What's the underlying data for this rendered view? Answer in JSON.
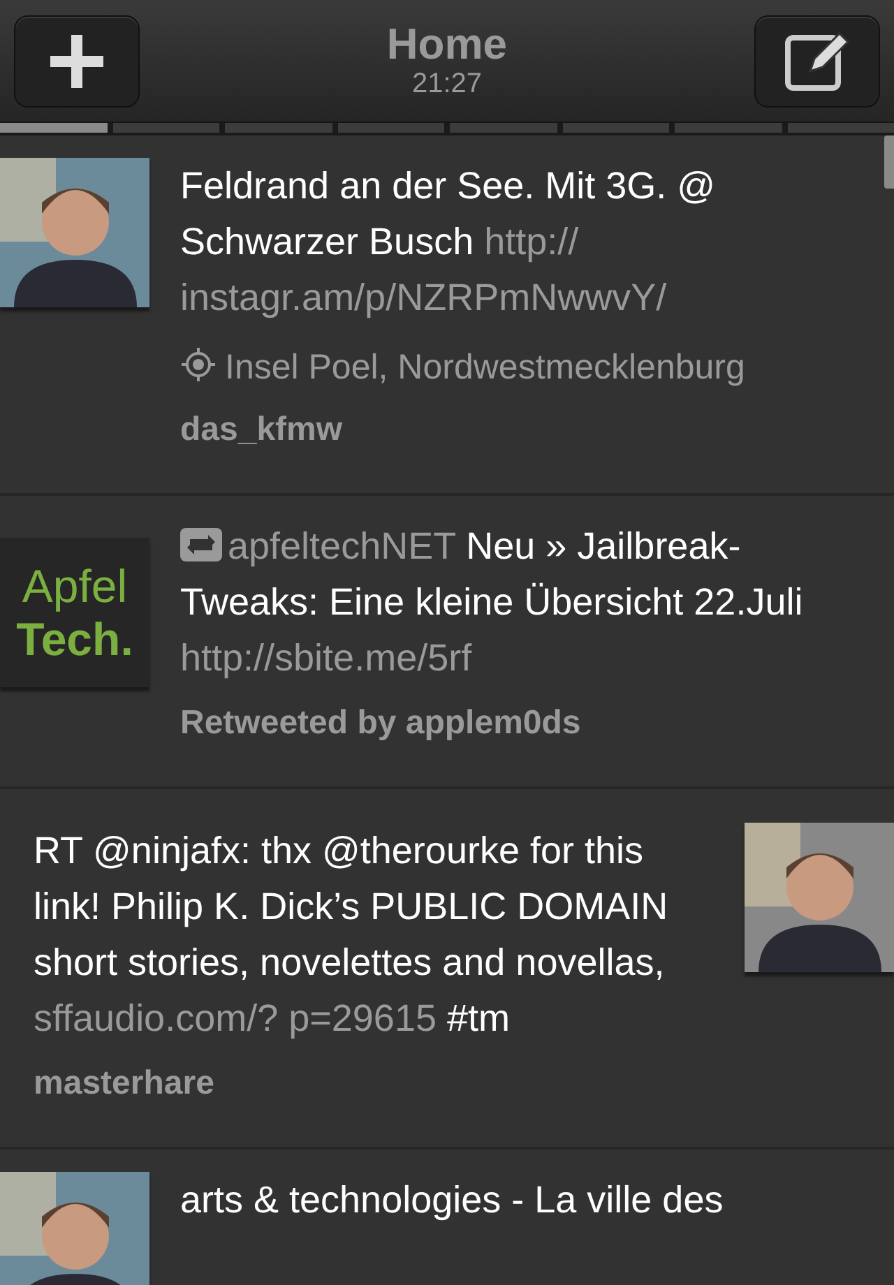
{
  "nav_bar": {
    "title": "Home",
    "time": "21:27"
  },
  "page_indicator": [
    {
      "selected": true
    },
    {
      "selected": false
    },
    {
      "selected": false
    },
    {
      "selected": false
    },
    {
      "selected": false
    },
    {
      "selected": false
    },
    {
      "selected": false
    },
    {
      "selected": false
    }
  ],
  "tweets": [
    {
      "kind": "left",
      "avatar": {
        "kind": "picture"
      },
      "retweet": false,
      "segments": [
        {
          "kind": "text",
          "text": "Feldrand an der See. Mit 3G.  @ Schwarzer Busch"
        },
        {
          "kind": "link",
          "text": "http:// instagr.am/p/NZRPmNwwvY/"
        }
      ],
      "location": "Insel Poel, Nordwestmecklenburg",
      "footer": "das_kfmw"
    },
    {
      "kind": "left",
      "avatar": {
        "kind": "logo",
        "lines": [
          "Apfel",
          "Tech."
        ]
      },
      "retweet": true,
      "segments": [
        {
          "kind": "link",
          "text": "apfeltechNET"
        },
        {
          "kind": "text",
          "text": "Neu » Jailbreak-Tweaks: Eine kleine Übersicht 22.Juli"
        },
        {
          "kind": "link",
          "text": "http://sbite.me/5rf"
        }
      ],
      "footer": "Retweeted by applem0ds"
    },
    {
      "kind": "right",
      "avatar": {
        "kind": "picture"
      },
      "retweet": false,
      "segments": [
        {
          "kind": "text",
          "text": "RT @ninjafx: thx @therourke for this link! Philip K. Dick’s PUBLIC DOMAIN short stories, novelettes and novellas,"
        },
        {
          "kind": "link",
          "text": " sffaudio.com/? p=29615"
        },
        {
          "kind": "text",
          "text": "#tm"
        }
      ],
      "footer": "masterhare"
    },
    {
      "kind": "left",
      "avatar": {
        "kind": "picture"
      },
      "retweet": false,
      "segments": [
        {
          "kind": "text",
          "text": "arts & technologies - La ville des"
        }
      ]
    }
  ]
}
